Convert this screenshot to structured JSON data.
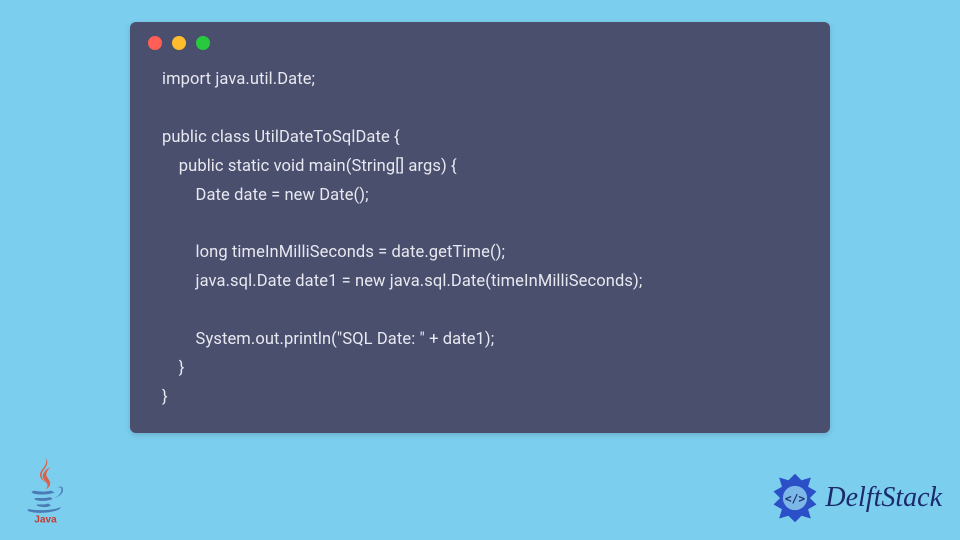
{
  "code": {
    "lines": [
      "import java.util.Date;",
      "",
      "public class UtilDateToSqlDate {",
      "    public static void main(String[] args) {",
      "        Date date = new Date();",
      "",
      "        long timeInMilliSeconds = date.getTime();",
      "        java.sql.Date date1 = new java.sql.Date(timeInMilliSeconds);",
      "",
      "        System.out.println(\"SQL Date: \" + date1);",
      "    }",
      "}"
    ]
  },
  "logos": {
    "java_label": "Java",
    "delftstack_label": "DelftStack"
  },
  "colors": {
    "background": "#7cceee",
    "window": "#4a4f6e",
    "text": "#e8e8f0",
    "dot_red": "#ff5f56",
    "dot_yellow": "#ffbd2e",
    "dot_green": "#27c93f",
    "delftstack_text": "#1b2a6b",
    "delftstack_accent": "#2a4fc7"
  }
}
